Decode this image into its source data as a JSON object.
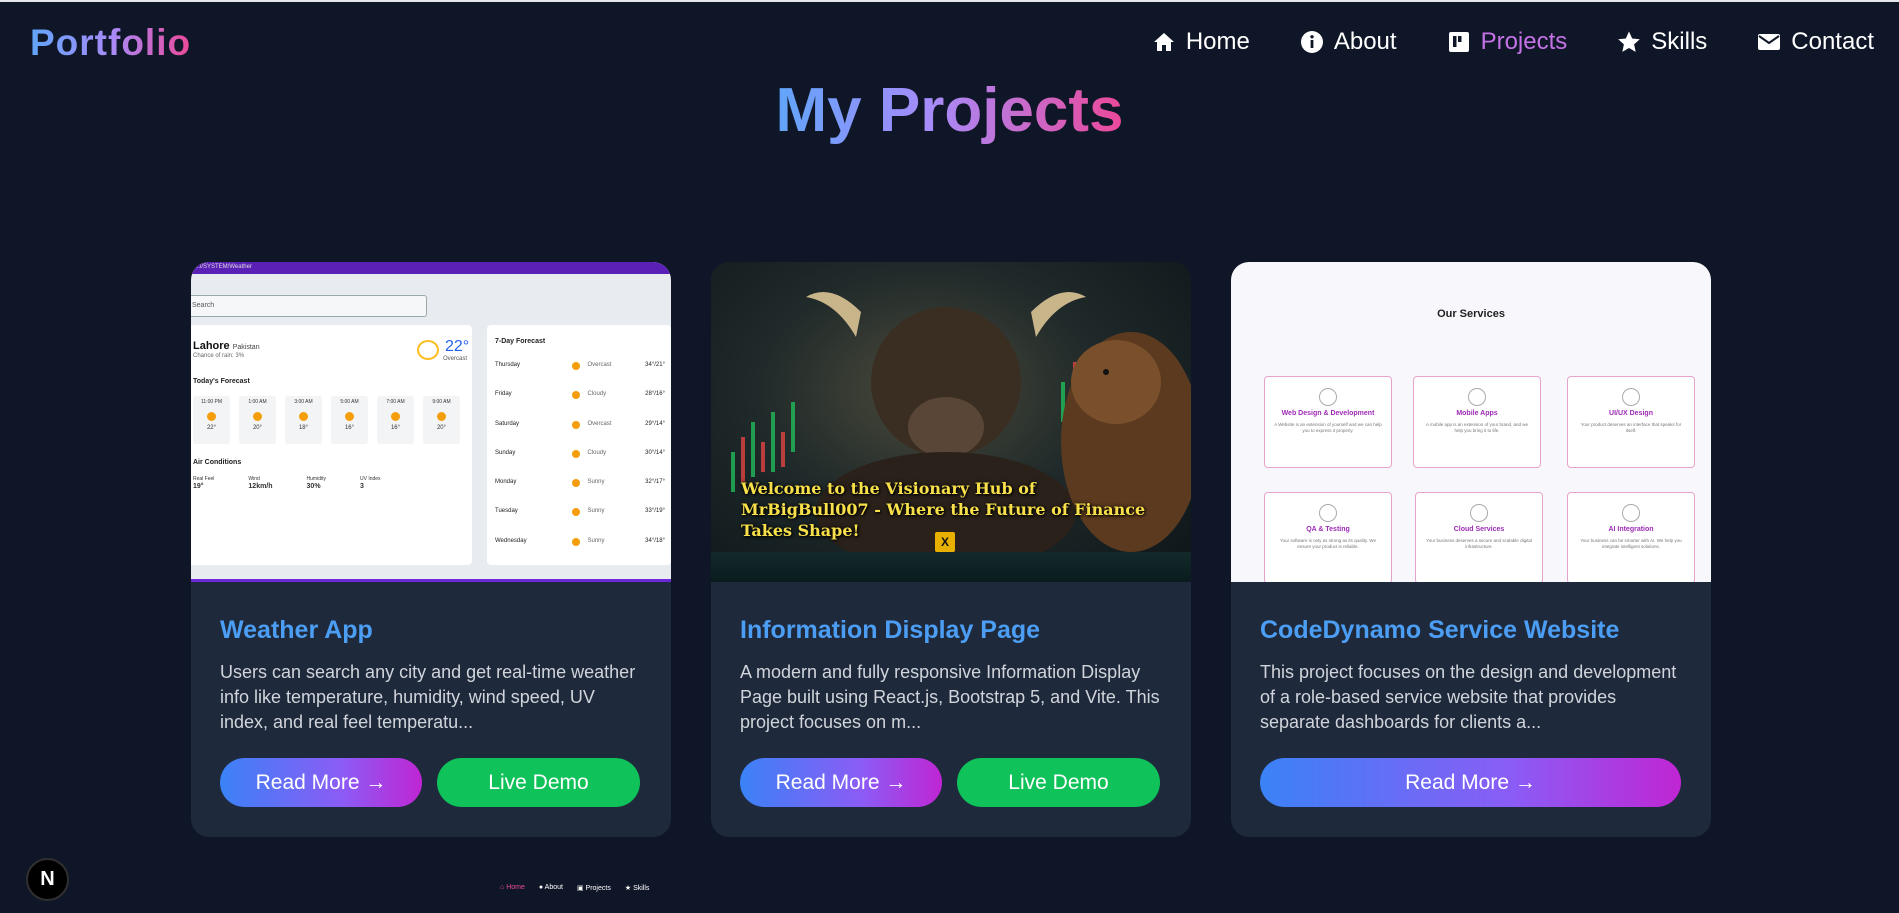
{
  "brand": "Portfolio",
  "nav": {
    "items": [
      {
        "label": "Home",
        "icon": "home-icon"
      },
      {
        "label": "About",
        "icon": "info-icon"
      },
      {
        "label": "Projects",
        "icon": "projects-icon"
      },
      {
        "label": "Skills",
        "icon": "star-icon"
      },
      {
        "label": "Contact",
        "icon": "mail-icon"
      }
    ],
    "active": "Projects"
  },
  "page_title": "My Projects",
  "projects": [
    {
      "title": "Weather App",
      "description": "Users can search any city and get real-time weather info like temperature, humidity, wind speed, UV index, and real feel temperatu...",
      "read_more": "Read More →",
      "live_demo": "Live Demo"
    },
    {
      "title": "Information Display Page",
      "description": "A modern and fully responsive Information Display Page built using React.js, Bootstrap 5, and Vite. This project focuses on m...",
      "read_more": "Read More →",
      "live_demo": "Live Demo"
    },
    {
      "title": "CodeDynamo Service Website",
      "description": "This project focuses on the design and development of a role-based service website that provides separate dashboards for clients a...",
      "read_more": "Read More →"
    }
  ],
  "weather_preview": {
    "url": "...i/SYSTEM/Weather",
    "search": "Search",
    "city": "Lahore",
    "country": "Pakistan",
    "chance": "Chance of rain: 3%",
    "temp": "22°",
    "condition": "Overcast",
    "today_heading": "Today's Forecast",
    "hours": [
      {
        "time": "11:00 PM",
        "temp": "22°"
      },
      {
        "time": "1:00 AM",
        "temp": "20°"
      },
      {
        "time": "3:00 AM",
        "temp": "18°"
      },
      {
        "time": "5:00 AM",
        "temp": "16°"
      },
      {
        "time": "7:00 AM",
        "temp": "16°"
      },
      {
        "time": "9:00 AM",
        "temp": "20°"
      }
    ],
    "air_heading": "Air Conditions",
    "air": [
      {
        "label": "Real Feel",
        "value": "19°"
      },
      {
        "label": "Wind",
        "value": "12km/h"
      },
      {
        "label": "Humidity",
        "value": "30%"
      },
      {
        "label": "UV Index",
        "value": "3"
      }
    ],
    "week_heading": "7-Day Forecast",
    "week": [
      {
        "day": "Thursday",
        "cond": "Overcast",
        "temp": "34°/21°"
      },
      {
        "day": "Friday",
        "cond": "Cloudy",
        "temp": "28°/16°"
      },
      {
        "day": "Saturday",
        "cond": "Overcast",
        "temp": "29°/14°"
      },
      {
        "day": "Sunday",
        "cond": "Cloudy",
        "temp": "30°/14°"
      },
      {
        "day": "Monday",
        "cond": "Sunny",
        "temp": "32°/17°"
      },
      {
        "day": "Tuesday",
        "cond": "Sunny",
        "temp": "33°/19°"
      },
      {
        "day": "Wednesday",
        "cond": "Sunny",
        "temp": "34°/18°"
      }
    ]
  },
  "bull_preview": {
    "headline": "Welcome to the Visionary Hub of MrBigBull007 - Where the Future of Finance Takes Shape!",
    "x_icon": "X"
  },
  "services_preview": {
    "heading": "Our Services",
    "items": [
      {
        "name": "Web Design & Development",
        "text": "A Website is an extension of yourself and we can help you to express it properly."
      },
      {
        "name": "Mobile Apps",
        "text": "A mobile app is an extension of your brand, and we help you bring it to life."
      },
      {
        "name": "UI/UX Design",
        "text": "Your product deserves an interface that speaks for itself."
      },
      {
        "name": "QA & Testing",
        "text": "Your software is only as strong as its quality. We ensure your product is reliable."
      },
      {
        "name": "Cloud Services",
        "text": "Your business deserves a secure and scalable digital infrastructure."
      },
      {
        "name": "AI Integration",
        "text": "Your business can be smarter with AI. We help you integrate intelligent solutions."
      }
    ]
  },
  "badge": "N",
  "mini_nav": [
    "Home",
    "About",
    "Projects",
    "Skills"
  ],
  "colors": {
    "background": "#0f1627",
    "card": "#1e293b",
    "title": "#4c9ef5",
    "active_nav": "#c472e6",
    "live_demo": "#10c25a"
  }
}
